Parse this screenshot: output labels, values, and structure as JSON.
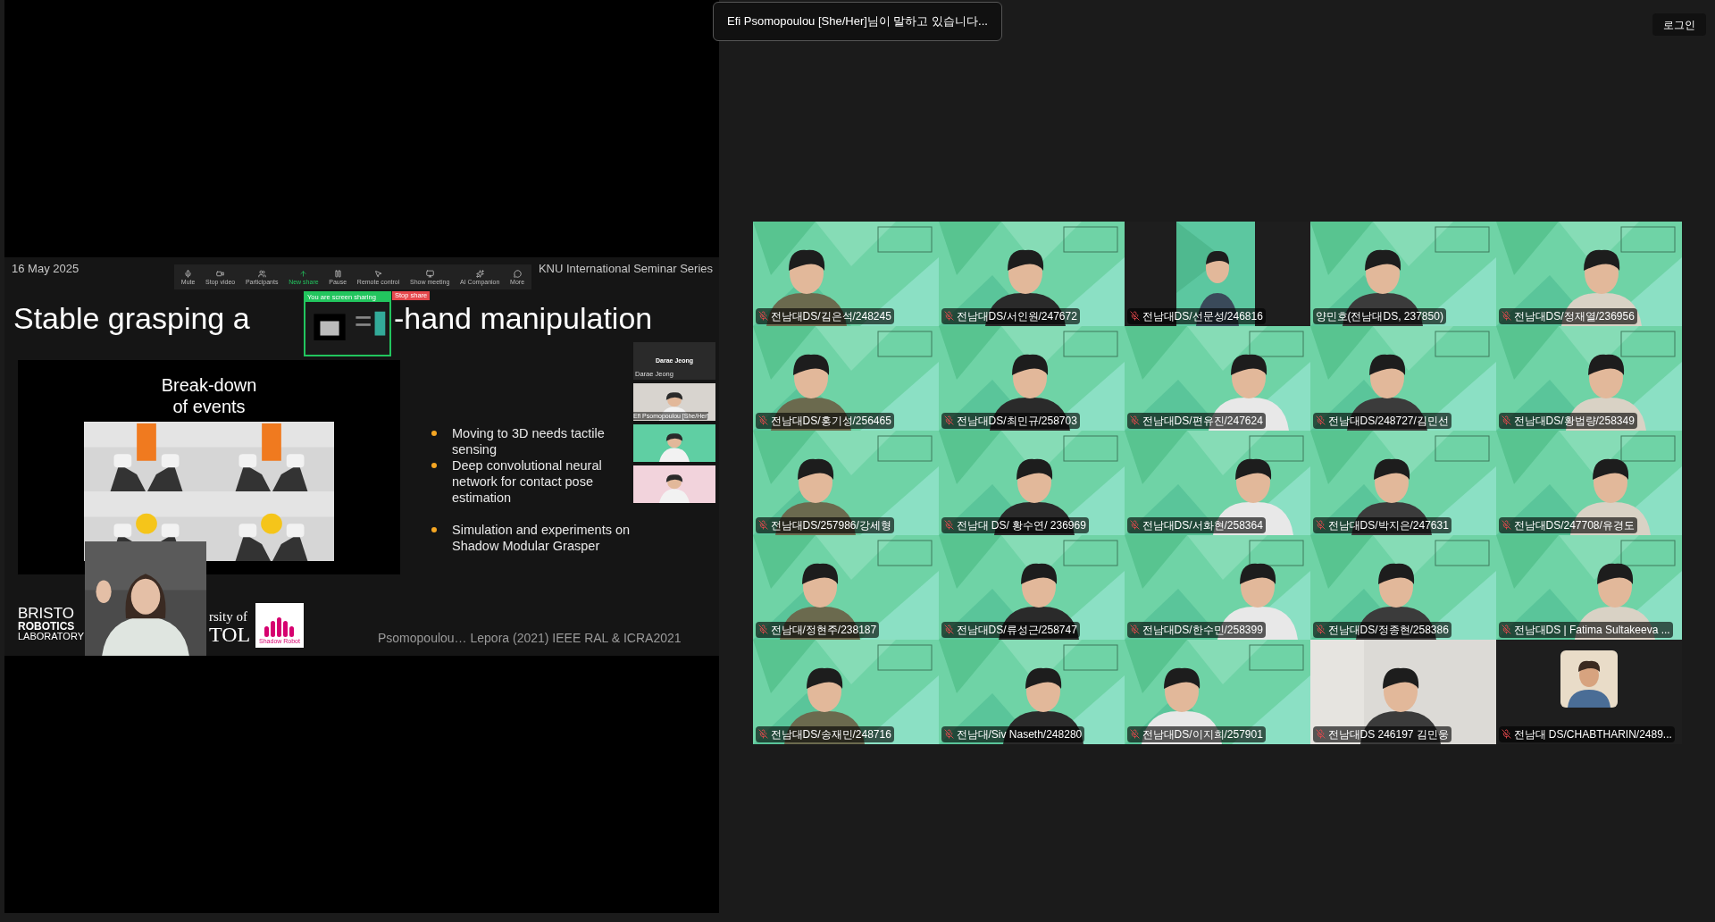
{
  "speaking_banner": "Efi Psomopoulou [She/Her]님이 말하고 있습니다...",
  "login_button": "로그인",
  "shared_screen": {
    "date": "16 May 2025",
    "series": "KNU International Seminar Series",
    "toolbar": [
      {
        "label": "Mute",
        "kind": "mic"
      },
      {
        "label": "Stop video",
        "kind": "video"
      },
      {
        "label": "Participants",
        "kind": "people"
      },
      {
        "label": "New share",
        "kind": "share"
      },
      {
        "label": "Pause",
        "kind": "pause"
      },
      {
        "label": "Remote control",
        "kind": "mouse"
      },
      {
        "label": "Show meeting",
        "kind": "monitor"
      },
      {
        "label": "AI Companion",
        "kind": "sparkle"
      },
      {
        "label": "More",
        "kind": "more"
      }
    ],
    "sharing_status": "You are screen sharing",
    "stop_share": "Stop share",
    "title_parts": [
      "Stable grasping a",
      "-hand manipulation"
    ],
    "figure_title": [
      "Break-down",
      "of events"
    ],
    "bullet_groups": [
      [
        "Moving to 3D needs tactile sensing",
        "Deep convolutional neural network for contact pose estimation"
      ],
      [
        "Simulation and experiments on Shadow Modular Grasper"
      ]
    ],
    "logo_lines": [
      "BRISTO",
      "ROBOTICS",
      "LABORATORY"
    ],
    "university_lines": [
      "rsity of",
      "TOL"
    ],
    "shadow_logo": "Shadow Robot",
    "citation": "Psomopoulou… Lepora (2021) IEEE RAL & ICRA2021",
    "side_panel": [
      {
        "kind": "name",
        "name": "Darae Jeong",
        "label": "Darae Jeong"
      },
      {
        "kind": "video",
        "label": "Efi Psomopoulou [She/Her]"
      },
      {
        "kind": "green"
      },
      {
        "kind": "pink"
      }
    ]
  },
  "participants": [
    {
      "name": "전남대DS/김은석/248245",
      "muted": true,
      "kind": "green"
    },
    {
      "name": "전남대DS/서인원/247672",
      "muted": true,
      "kind": "green"
    },
    {
      "name": "전남대DS/선문성/246816",
      "muted": true,
      "kind": "strip"
    },
    {
      "name": "양민호(전남대DS, 237850)",
      "muted": false,
      "kind": "green"
    },
    {
      "name": "전남대DS/정재열/236956",
      "muted": true,
      "kind": "green"
    },
    {
      "name": "전남대DS/홍기성/256465",
      "muted": true,
      "kind": "green"
    },
    {
      "name": "전남대DS/최민규/258703",
      "muted": true,
      "kind": "green"
    },
    {
      "name": "전남대DS/편유진/247624",
      "muted": true,
      "kind": "green"
    },
    {
      "name": "전남대DS/248727/김민선",
      "muted": true,
      "kind": "green"
    },
    {
      "name": "전남대DS/황법량/258349",
      "muted": true,
      "kind": "green"
    },
    {
      "name": "전남대DS/257986/강세형",
      "muted": true,
      "kind": "green"
    },
    {
      "name": "전남대 DS/ 황수연/ 236969",
      "muted": true,
      "kind": "green"
    },
    {
      "name": "전남대DS/서화현/258364",
      "muted": true,
      "kind": "green"
    },
    {
      "name": "전남대DS/박지은/247631",
      "muted": true,
      "kind": "green"
    },
    {
      "name": "전남대DS/247708/유경도",
      "muted": true,
      "kind": "green"
    },
    {
      "name": "전남대/정현주/238187",
      "muted": true,
      "kind": "green"
    },
    {
      "name": "전남대DS/류성근/258747",
      "muted": true,
      "kind": "green"
    },
    {
      "name": "전남대DS/한수민/258399",
      "muted": true,
      "kind": "green"
    },
    {
      "name": "전남대DS/정종현/258386",
      "muted": true,
      "kind": "green"
    },
    {
      "name": "전남대DS | Fatima Sultakeeva ...",
      "muted": true,
      "kind": "green"
    },
    {
      "name": "전남대DS/송재민/248716",
      "muted": true,
      "kind": "green"
    },
    {
      "name": "전남대/Siv Naseth/248280",
      "muted": true,
      "kind": "green"
    },
    {
      "name": "전남대DS/이지희/257901",
      "muted": true,
      "kind": "green"
    },
    {
      "name": "전남대DS 246197 김민웅",
      "muted": true,
      "kind": "plain"
    },
    {
      "name": "전남대 DS/CHABTHARIN/2489...",
      "muted": true,
      "kind": "avatar"
    }
  ]
}
